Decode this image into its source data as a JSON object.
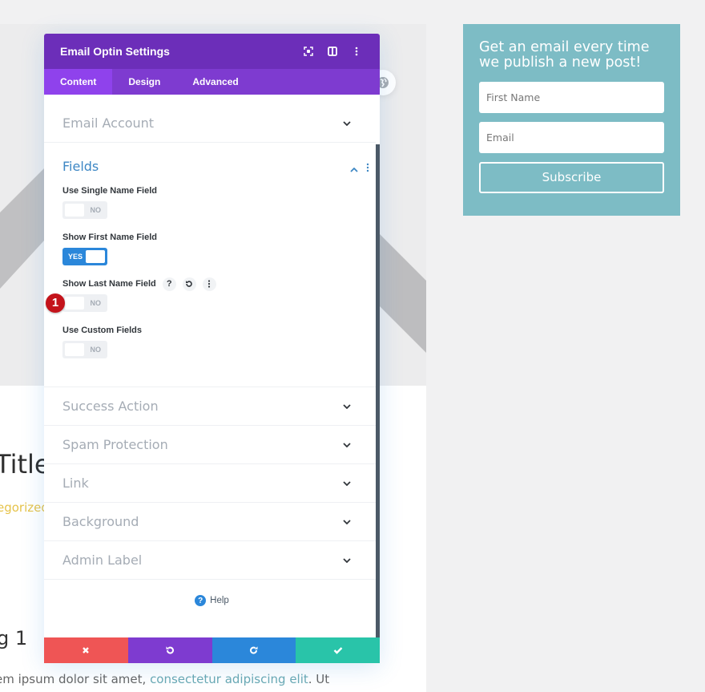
{
  "background_page": {
    "post_title": "Title",
    "post_category": "egorized",
    "post_heading": "g 1",
    "post_text_plain": "em ipsum dolor sit amet, ",
    "post_text_link": "consectetur adipiscing elit",
    "post_text_after": ". Ut"
  },
  "optin_widget": {
    "title": "Get an email every time we publish a new post!",
    "first_name_placeholder": "First Name",
    "email_placeholder": "Email",
    "subscribe_label": "Subscribe",
    "background_color": "#7dbcc5"
  },
  "modal": {
    "title": "Email Optin Settings",
    "header_icons": [
      "expand-icon",
      "split-view-icon",
      "more-options-icon"
    ],
    "tabs": [
      {
        "label": "Content",
        "active": true
      },
      {
        "label": "Design",
        "active": false
      },
      {
        "label": "Advanced",
        "active": false
      }
    ],
    "sections_before": [
      {
        "label": "Email Account"
      }
    ],
    "fields_section": {
      "title": "Fields",
      "options": [
        {
          "label": "Use Single Name Field",
          "value": "NO",
          "on": false
        },
        {
          "label": "Show First Name Field",
          "value": "YES",
          "on": true
        },
        {
          "label": "Show Last Name Field",
          "value": "NO",
          "on": false,
          "hovered": true,
          "badge": "1"
        },
        {
          "label": "Use Custom Fields",
          "value": "NO",
          "on": false
        }
      ]
    },
    "sections_after": [
      {
        "label": "Success Action"
      },
      {
        "label": "Spam Protection"
      },
      {
        "label": "Link"
      },
      {
        "label": "Background"
      },
      {
        "label": "Admin Label"
      }
    ],
    "help_label": "Help",
    "footer_buttons": [
      "cancel",
      "undo",
      "redo",
      "save"
    ],
    "colors": {
      "header": "#6c2eb9",
      "tabs": "#7e3bd0",
      "active_tab": "#8f42ec",
      "cancel": "#ef5555",
      "undo": "#7e3bd0",
      "redo": "#2b87da",
      "save": "#29c4a9",
      "toggle_on": "#2b87da"
    }
  }
}
